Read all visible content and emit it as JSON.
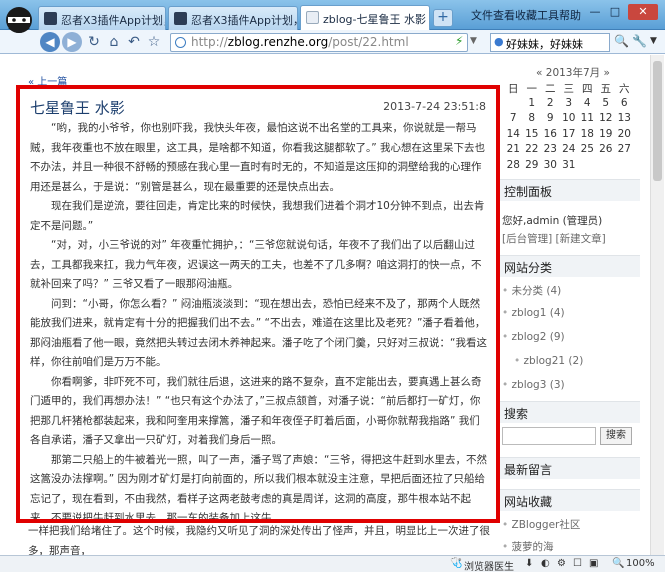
{
  "tabs": [
    {
      "title": "忍者X3插件App计划，铺造",
      "active": false
    },
    {
      "title": "忍者X3插件App计划，铺造",
      "active": false
    },
    {
      "title": "zblog-七星鲁王 水影",
      "active": true
    }
  ],
  "menu": [
    "文件",
    "查看",
    "收藏",
    "工具",
    "帮助"
  ],
  "window_controls": [
    "—",
    "□",
    "✕"
  ],
  "newtab_label": "+",
  "address": {
    "prefix": "http://",
    "domain": "zblog.renzhe.org",
    "path": "/post/22.html"
  },
  "toolbar_search_text": "好妹妹，好妹妹",
  "colors": {
    "accent": "#e00000",
    "link": "#1f4fa0",
    "title": "#1d3f6e"
  },
  "page": {
    "prev_link": "« 上一篇",
    "post_title": "七星鲁王 水影",
    "post_date": "2013-7-24 23:51:8",
    "paragraphs": [
      "“哟，我的小爷爷，你也别吓我，我快头年夜，最怕这说不出名堂的工具来，你说就是一帮马贼，我年夜重也不放在眼里，这工具，是啥都不知道，你看我这腿都软了。” 我心想在这里呆下去也不办法，并且一种很不舒畅的预感在我心里一直时有时无的，不知道是这压抑的洞壁给我的心理作用还是甚么，于是说：“别管是甚么，现在最重要的还是快点出去。",
      "现在我们是逆流，要往回走，肯定比来的时候快，我想我们进着个洞才10分钟不到点，出去肯定不是问题。”",
      "“对，对，小三爷说的对” 年夜重忙拥护，：“三爷您就说句话，年夜不了我们出了以后翻山过去，工具都我来扛，我力气年夜，迟误这一两天的工夫，也差不了几多啊？咱这洞打的快一点，不就补回来了吗？” 三爷又看了一眼那闷油瓶。",
      "问到：“小哥，你怎么看？” 闷油瓶淡淡到：“现在想出去，恐怕已经来不及了，那两个人既然能放我们进来，就肯定有十分的把握我们出不去。” “不出去，难道在这里比及老死？”潘子看着他，那闷油瓶看了他一眼，竟然把头转过去闭木养神起来。潘子吃了个闭门羹，只好对三叔说：“我看这样，你往前咱们是万万不能。",
      "你看啊爹，非吓死不可，我们就往后退，这进来的路不复杂，直不定能出去，要真遇上甚么奇门遁甲的，我们再想办法！” “也只有这个办法了，”三叔点颔首，对潘子说：“前后都打一矿灯，你把那几杆猪枪都装起来，我和阿奎用来撑篙，潘子和年夜侄子盯着后面，小哥你就帮我指路” 我们各自承诺，潘子又拿出一只矿灯，对着我们身后一照。",
      "那第二只船上的牛被着光一照，叫了一声，潘子骂了声娘：“三爷，得把这牛赶到水里去，不然这篙没办法撑啊。” 因为刚才矿灯是打向前面的，所以我们根本就没主注意，早把后面还拉了只船给忘记了，现在看到，不由我然，看样子这两老鼓考虑的真是周详，这洞的高度，那牛根本站不起来，不要说把牛赶到水里去，那一车的装备加上这牛。"
    ],
    "below_text": "一样把我们给堵住了。这个时候，我隐约又听见了洞的深处传出了怪声，并且，明显比上一次进了很多，那声音，"
  },
  "calendar": {
    "header": "« 2013年7月 »",
    "rows": [
      [
        "日",
        "一",
        "二",
        "三",
        "四",
        "五",
        "六"
      ],
      [
        "",
        "1",
        "2",
        "3",
        "4",
        "5",
        "6"
      ],
      [
        "7",
        "8",
        "9",
        "10",
        "11",
        "12",
        "13"
      ],
      [
        "14",
        "15",
        "16",
        "17",
        "18",
        "19",
        "20"
      ],
      [
        "21",
        "22",
        "23",
        "24",
        "25",
        "26",
        "27"
      ],
      [
        "28",
        "29",
        "30",
        "31",
        "",
        "",
        ""
      ]
    ]
  },
  "sidebar": {
    "control_panel_title": "控制面板",
    "greeting": "您好,admin (管理员)",
    "admin_links": [
      "[后台管理]",
      "[新建文章]"
    ],
    "categories_title": "网站分类",
    "categories": [
      "未分类 (4)",
      "zblog1 (4)",
      "zblog2 (9)",
      "zblog21 (2)",
      "zblog3 (3)"
    ],
    "search_title": "搜索",
    "search_button": "搜索",
    "recent_title": "最新留言",
    "favorites_title": "网站收藏",
    "favorites": [
      "ZBlogger社区",
      "菠萝的海"
    ]
  },
  "statusbar": {
    "engine": "浏览器医生",
    "zoom": "100%"
  }
}
